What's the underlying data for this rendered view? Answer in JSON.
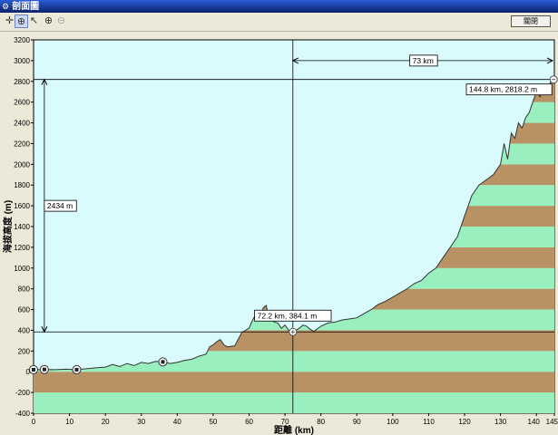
{
  "window": {
    "title": "剖面圖",
    "title_icon": "app-icon"
  },
  "toolbar": {
    "tools": [
      {
        "name": "pan-icon",
        "glyph": "✛",
        "active": false,
        "disabled": false
      },
      {
        "name": "crosshair-icon",
        "glyph": "⊕",
        "active": true,
        "disabled": false
      },
      {
        "name": "pointer-icon",
        "glyph": "↖",
        "active": false,
        "disabled": false
      },
      {
        "name": "zoom-in-icon",
        "glyph": "⊕",
        "active": false,
        "disabled": false
      },
      {
        "name": "zoom-out-icon",
        "glyph": "⊖",
        "active": false,
        "disabled": true
      }
    ],
    "close_label": "關閉"
  },
  "chart_data": {
    "type": "area",
    "xlabel": "距離 (km)",
    "ylabel": "海拔高度 (m)",
    "xlim": [
      0,
      145
    ],
    "ylim": [
      -400,
      3200
    ],
    "x_ticks": [
      0,
      10,
      20,
      30,
      40,
      50,
      60,
      70,
      80,
      90,
      100,
      110,
      120,
      130,
      140,
      145
    ],
    "x_tick_labels": [
      "0",
      "10",
      "20",
      "30",
      "40",
      "50",
      "60",
      "70",
      "80",
      "90",
      "100",
      "110",
      "120",
      "130",
      "140",
      "145"
    ],
    "y_ticks": [
      -400,
      -200,
      0,
      200,
      400,
      600,
      800,
      1000,
      1200,
      1400,
      1600,
      1800,
      2000,
      2200,
      2400,
      2600,
      2800,
      3000,
      3200
    ],
    "y_tick_labels": [
      "-400",
      "-200",
      "0",
      "200",
      "400",
      "600",
      "800",
      "1000",
      "1200",
      "1400",
      "1600",
      "1800",
      "2000",
      "2200",
      "2400",
      "2600",
      "2800",
      "3000",
      "3200"
    ],
    "band_height": 200,
    "colors": {
      "band_brown": "#b89265",
      "band_green": "#99efbd",
      "sky": "#d9fbfd",
      "line": "#333333"
    },
    "profile": {
      "x": [
        0,
        3,
        6,
        9,
        12,
        15,
        18,
        20,
        22,
        24,
        26,
        28,
        30,
        32,
        34,
        36,
        38,
        40,
        42,
        44,
        46,
        48,
        49,
        50,
        51,
        52,
        53,
        54,
        56,
        58,
        60,
        61,
        62,
        63,
        64,
        64.8,
        65,
        66,
        67,
        68,
        69,
        70,
        71,
        72.2,
        73,
        74,
        75,
        76,
        77,
        78,
        80,
        82,
        84,
        86,
        88,
        90,
        92,
        94,
        96,
        98,
        100,
        102,
        104,
        106,
        108,
        110,
        112,
        114,
        116,
        118,
        120,
        122,
        124,
        126,
        128,
        130,
        131,
        132,
        133,
        134,
        135,
        136,
        137,
        138,
        139,
        140,
        141,
        142,
        143,
        144,
        144.8,
        145
      ],
      "y": [
        20,
        22,
        20,
        25,
        20,
        30,
        40,
        45,
        70,
        50,
        80,
        60,
        90,
        80,
        100,
        95,
        80,
        90,
        110,
        120,
        150,
        170,
        240,
        260,
        290,
        310,
        260,
        240,
        250,
        380,
        420,
        500,
        560,
        540,
        620,
        640,
        600,
        520,
        480,
        470,
        420,
        450,
        400,
        384,
        400,
        420,
        450,
        440,
        410,
        390,
        440,
        470,
        480,
        500,
        510,
        520,
        560,
        600,
        650,
        680,
        720,
        760,
        800,
        850,
        880,
        950,
        1000,
        1100,
        1200,
        1300,
        1500,
        1700,
        1800,
        1850,
        1900,
        2000,
        2200,
        2050,
        2300,
        2250,
        2400,
        2350,
        2450,
        2500,
        2600,
        2700,
        2650,
        2750,
        2700,
        2800,
        2780,
        2818.2,
        2820
      ]
    },
    "markers": {
      "x": [
        0,
        3,
        12,
        36
      ],
      "y": [
        20,
        22,
        20,
        95
      ],
      "icon": "marker-square-icon"
    },
    "end_marker": {
      "x": 144.8,
      "y": 2818.2,
      "icon": "end-point-icon"
    },
    "cursor_point": {
      "x": 72.2,
      "y": 384.1,
      "icon": "cursor-point-icon"
    },
    "annotations": {
      "cursor_label": "72.2 km, 384.1 m",
      "end_label": "144.8 km, 2818.2 m",
      "distance_label": "73 km",
      "height_diff_label": "2434 m"
    },
    "guides": {
      "vertical_x": 72.2,
      "horizontal_y": [
        2818.2,
        384.1
      ],
      "distance_from_x": 72.2,
      "distance_to_x": 145,
      "distance_y": 3000,
      "height_diff_x": 3,
      "height_diff_label_y": 1600
    }
  }
}
